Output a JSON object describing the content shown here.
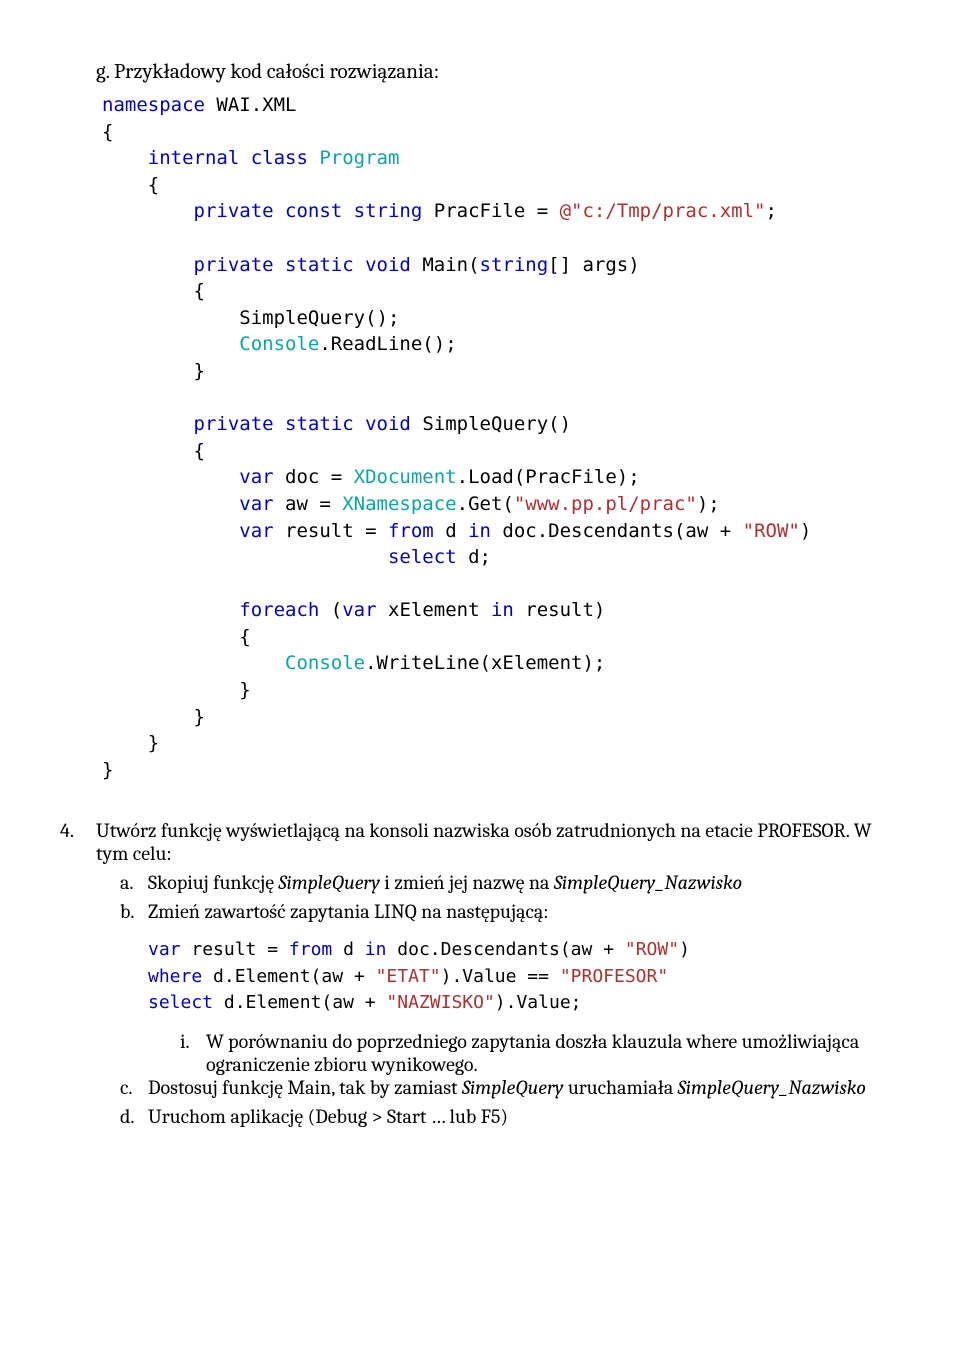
{
  "g_heading": "g.   Przykładowy kod całości rozwiązania:",
  "code": {
    "l1a": "namespace",
    "l1b": " WAI.XML",
    "l2": "{",
    "l3a": "    internal",
    "l3b": " class",
    "l3c": " Program",
    "l4": "    {",
    "l5a": "        private",
    "l5b": " const",
    "l5c": " string",
    "l5d": " PracFile = ",
    "l5e": "@\"c:/Tmp/prac.xml\"",
    "l5f": ";",
    "l6": " ",
    "l7a": "        private",
    "l7b": " static",
    "l7c": " void",
    "l7d": " Main(",
    "l7e": "string",
    "l7f": "[] args)",
    "l8": "        {",
    "l9": "            SimpleQuery();",
    "l10a": "            ",
    "l10b": "Console",
    "l10c": ".ReadLine();",
    "l11": "        }",
    "l12": " ",
    "l13a": "        private",
    "l13b": " static",
    "l13c": " void",
    "l13d": " SimpleQuery()",
    "l14": "        {",
    "l15a": "            var",
    "l15b": " doc = ",
    "l15c": "XDocument",
    "l15d": ".Load(PracFile);",
    "l16a": "            var",
    "l16b": " aw = ",
    "l16c": "XNamespace",
    "l16d": ".Get(",
    "l16e": "\"www.pp.pl/prac\"",
    "l16f": ");",
    "l17a": "            var",
    "l17b": " result = ",
    "l17c": "from",
    "l17d": " d ",
    "l17e": "in",
    "l17f": " doc.Descendants(aw + ",
    "l17g": "\"ROW\"",
    "l17h": ")",
    "l18a": "                         ",
    "l18b": "select",
    "l18c": " d;",
    "l19": " ",
    "l20a": "            foreach",
    "l20b": " (",
    "l20c": "var",
    "l20d": " xElement ",
    "l20e": "in",
    "l20f": " result)",
    "l21": "            {",
    "l22a": "                ",
    "l22b": "Console",
    "l22c": ".WriteLine(xElement);",
    "l23": "            }",
    "l24": "        }",
    "l25": "    }",
    "l26": "}"
  },
  "p4": {
    "num": "4.",
    "text1": "Utwórz funkcję wyświetlającą na konsoli nazwiska osób zatrudnionych na etacie PROFESOR. W tym celu:"
  },
  "a": {
    "num": "a.",
    "t1": "Skopiuj funkcję ",
    "i1": "SimpleQuery",
    "t2": " i zmień jej nazwę na ",
    "i2": "SimpleQuery_Nazwisko"
  },
  "b": {
    "num": "b.",
    "t1": "Zmień zawartość zapytania LINQ na następującą:"
  },
  "linq": {
    "l1a": "var",
    "l1b": " result = ",
    "l1c": "from",
    "l1d": " d ",
    "l1e": "in",
    "l1f": " doc.Descendants(aw + ",
    "l1g": "\"ROW\"",
    "l1h": ")",
    "l2a": "where",
    "l2b": " d.Element(aw + ",
    "l2c": "\"ETAT\"",
    "l2d": ").Value == ",
    "l2e": "\"PROFESOR\"",
    "l3a": "select",
    "l3b": " d.Element(aw + ",
    "l3c": "\"NAZWISKO\"",
    "l3d": ").Value;"
  },
  "bi": {
    "num": "i.",
    "t1": "W porównaniu do poprzedniego zapytania doszła klauzula where umożliwiająca ograniczenie zbioru wynikowego."
  },
  "c": {
    "num": "c.",
    "t1": "Dostosuj funkcję Main, tak by zamiast ",
    "i1": "SimpleQuery",
    "t2": " uruchamiała ",
    "i2": "SimpleQuery_Nazwisko"
  },
  "d": {
    "num": "d.",
    "t1": "Uruchom aplikację (Debug > Start … lub F5)"
  }
}
